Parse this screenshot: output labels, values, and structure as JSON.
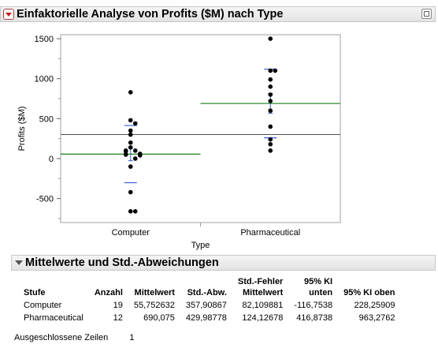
{
  "header": {
    "title": "Einfaktorielle Analyse von Profits ($M) nach Type"
  },
  "chart_data": {
    "type": "scatter",
    "xlabel": "Type",
    "ylabel": "Profits ($M)",
    "categories": [
      "Computer",
      "Pharmaceutical"
    ],
    "ylim": [
      -800,
      1550
    ],
    "yticks": [
      -500,
      0,
      500,
      1000,
      1500
    ],
    "grand_mean": 301.5,
    "group_means": [
      55.752632,
      690.075
    ],
    "group_std": [
      357.90867,
      429.98778
    ],
    "group_se": [
      82.109881,
      124.12678
    ],
    "points": [
      {
        "group": 0,
        "values": [
          830,
          480,
          440,
          350,
          300,
          200,
          140,
          100,
          100,
          90,
          60,
          50,
          50,
          40,
          0,
          -100,
          -420,
          -660,
          -660
        ]
      },
      {
        "group": 1,
        "values": [
          1500,
          1100,
          1100,
          990,
          900,
          800,
          720,
          600,
          400,
          240,
          180,
          100
        ]
      }
    ],
    "colors": {
      "mean_line": "#2e8b2e",
      "grand_mean_line": "#505050",
      "std_marks": "#3a5bd0",
      "points": "#000000"
    }
  },
  "section2": {
    "title": "Mittelwerte und Std.-Abweichungen"
  },
  "table": {
    "headers": [
      {
        "line1": "",
        "line2": "Stufe"
      },
      {
        "line1": "",
        "line2": "Anzahl"
      },
      {
        "line1": "",
        "line2": "Mittelwert"
      },
      {
        "line1": "",
        "line2": "Std.-Abw."
      },
      {
        "line1": "Std.-Fehler",
        "line2": "Mittelwert"
      },
      {
        "line1": "95% KI",
        "line2": "unten"
      },
      {
        "line1": "",
        "line2": "95% KI oben"
      }
    ],
    "rows": [
      [
        "Computer",
        "19",
        "55,752632",
        "357,90867",
        "82,109881",
        "-116,7538",
        "228,25909"
      ],
      [
        "Pharmaceutical",
        "12",
        "690,075",
        "429,98778",
        "124,12678",
        "416,8738",
        "963,2762"
      ]
    ]
  },
  "excluded": {
    "label": "Ausgeschlossene Zeilen",
    "value": "1"
  }
}
